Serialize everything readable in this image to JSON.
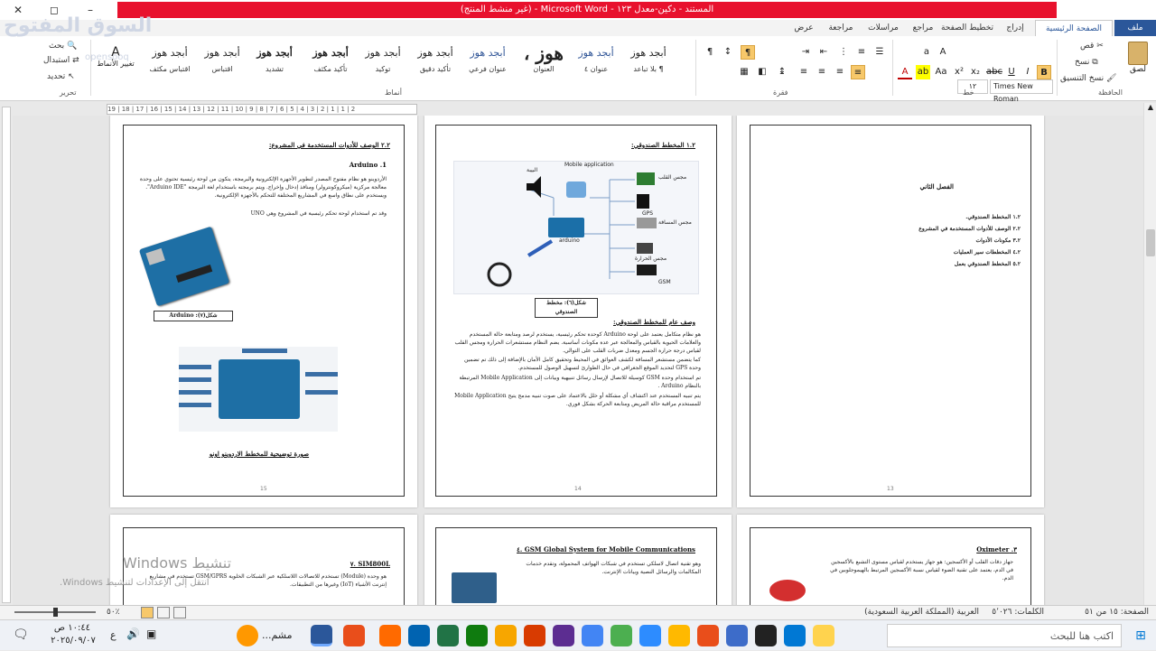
{
  "window": {
    "title": "المستند - دكين-معدل ١٢٣ - Microsoft Word - (غير منشط المنتج)",
    "minimize": "–",
    "restore": "◻",
    "close": "✕"
  },
  "tabs": [
    "ملف",
    "الصفحة الرئيسية",
    "إدراج",
    "تخطيط الصفحة",
    "مراجع",
    "مراسلات",
    "مراجعة",
    "عرض"
  ],
  "clipboard": {
    "cut": "قص",
    "copy": "نسخ",
    "format_painter": "نسخ التنسيق",
    "paste": "لصق",
    "label": "الحافظة"
  },
  "font": {
    "name": "Times New Roman",
    "size": "١٢",
    "label": "خط"
  },
  "paragraph": {
    "label": "فقرة"
  },
  "styles": {
    "label": "أنماط",
    "items": [
      {
        "sample": "أبجد هوز",
        "name": "¶ بلا تباعد"
      },
      {
        "sample": "أبجد هوز",
        "name": "عنوان ٤"
      },
      {
        "sample": "هوز ،",
        "name": "العنوان"
      },
      {
        "sample": "أبجد هوز",
        "name": "عنوان فرعي"
      },
      {
        "sample": "أبجد هوز",
        "name": "تأكيد دقيق"
      },
      {
        "sample": "أبجد هوز",
        "name": "توكيد"
      },
      {
        "sample": "أبجد هوز",
        "name": "تأكيد مكثف"
      },
      {
        "sample": "أبجد هوز",
        "name": "تشديد"
      },
      {
        "sample": "أبجد هوز",
        "name": "اقتباس"
      },
      {
        "sample": "أبجد هوز",
        "name": "اقتباس مكثف"
      }
    ],
    "change_styles": "تغيير الأنماط"
  },
  "editing": {
    "find": "بحث",
    "replace": "استبدال",
    "select": "تحديد",
    "label": "تحرير"
  },
  "ruler_text": "19 | 18 | 17 | 16 | 15 | 14 | 13 | 12 | 11 | 10 | 9 | 8 | 7 | 6 | 5 | 4 | 3 | 2 | 1 | 1 | 2",
  "pages": {
    "p13": {
      "chapter": "الفصل الثاني",
      "items": [
        "١.٢ المخطط الصندوقي.",
        "٢.٢ الوصف للأدوات المستخدمة في المشروع",
        "٣.٢ مكونات الأدوات",
        "٤.٢ المخططات سير العمليات",
        "٥.٢ المخطط الصندوقي بعمل"
      ],
      "page_number": "13"
    },
    "p14": {
      "title": "١.٢ المخطط الصندوقي:",
      "diagram_labels": {
        "app": "Mobile application",
        "gps": "GPS",
        "arduino": "arduino",
        "gsm": "GSM",
        "speaker": "البيبة",
        "sensor1": "مجس القلب",
        "sensor2": "مجس المسافة",
        "sensor3": "مجس الحرارة"
      },
      "caption": "شكل(٦): مخطط الصندوقي",
      "section": "وصف عام للمخطط الصندوقي:",
      "para1": "هو نظام متكامل يعتمد على لوحة Arduino كوحدة تحكم رئيسية، يستخدم لرصد ومتابعة حالة المستخدم والعلامات الحيوية بالقياس والمعالجة عبر عدة مكونات أساسية. يضم النظام مستشعرات الحرارة ومجس القلب لقياس درجة حرارة الجسم ومعدل ضربات القلب على التوالي.",
      "para2": "كما يتضمن مستشعر المسافة لكشف العوائق في المحيط وتحقيق كامل الأمان بالإضافة إلى ذلك تم تضمين وحدة GPS لتحديد الموقع الجغرافي في حال الطوارئ لتسهيل الوصول للمستخدم.",
      "para3": "تم استخدام وحدة GSM كوسيلة للاتصال لإرسال رسائل تنبيهية وبيانات إلى Mobile Application المرتبطة بالنظام Arduino .",
      "para4": "يتم تنبيه المستخدم عند اكتشاف أي مشكلة أو خلل بالاعتماد على صوت تنبيه مدمج يتيح Mobile Application للمستخدم مراقبة حالة المريض ومتابعة الحركة بشكل فوري.",
      "page_number": "14"
    },
    "p15": {
      "title": "٢.٢ الوصف للأدوات المستخدمة في المشروع:",
      "subtitle": "Arduino .1",
      "para1": "الأردوينو هو نظام مفتوح المصدر لتطوير الأجهزة الإلكترونية والبرمجة، يتكون من لوحة رئيسية تحتوي على وحدة معالجة مركزية (ميكروكونترولر) ومنافذ إدخال وإخراج. ويتم برمجته باستخدام لغة البرمجة \"Arduino IDE\". ويستخدم على نطاق واسع في المشاريع المختلفة للتحكم بالأجهزة الإلكترونية.",
      "para2": "وقد تم استخدام لوحة تحكم رئيسية في المشروع وهي UNO",
      "caption": "شكل(٧): Arduino",
      "pinout_caption": "صورة توضيحية للمخطط الاردوينو اونو",
      "page_number": "15"
    },
    "p16": {
      "title": "٣. Oximeter",
      "text": "جهاز دقات القلب أو الأكسجين: هو جهاز يستخدم لقياس مستوى التشبع بالأكسجين في الدم، يعتمد على تقنية الضوء لقياس نسبة الأكسجين المرتبط بالهيموجلوبين في الدم."
    },
    "p17": {
      "title": "٤. GSM Global System for Mobile Communications",
      "text": "وهو تقنية اتصال لاسلكي تستخدم في شبكات الهواتف المحمولة، وتقدم خدمات المكالمات والرسائل النصية وبيانات الإنترنت."
    },
    "p18": {
      "title": "٧. SIM800L",
      "text": "هو وحدة (Module) تستخدم للاتصالات اللاسلكية عبر الشبكات الخلوية GSM/GPRS تستخدم في مشاريع إنترنت الأشياء (IoT) وغيرها من التطبيقات."
    }
  },
  "activation": {
    "line1": "تنشيط Windows",
    "line2": "انتقل إلى الإعدادات لتنشيط Windows."
  },
  "statusbar": {
    "page": "الصفحة: ١٥ من ٥١",
    "words": "الكلمات: ٥٬٠٢٦",
    "language": "العربية (المملكة العربية السعودية)",
    "zoom": "٥٠٪"
  },
  "taskbar": {
    "search_placeholder": "اكتب هنا للبحث",
    "time": "١٠:٤٤ ص",
    "date": "٢٠٢٥/٠٩/٠٧",
    "lang": "ع",
    "running_label": "مشم..."
  },
  "watermark_logo": {
    "text": "السوق المفتوح",
    "sub": "opensooq"
  },
  "colors": {
    "word_blue": "#2b579a",
    "title_red": "#e8112d",
    "highlight": "#f7c86a"
  }
}
